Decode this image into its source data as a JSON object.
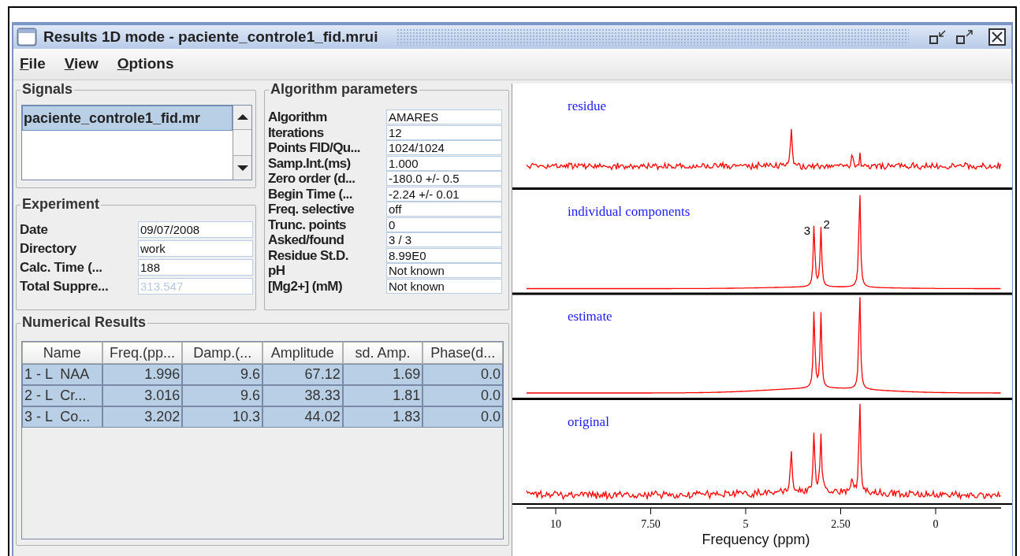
{
  "window": {
    "title": "Results 1D mode - paciente_controle1_fid.mrui"
  },
  "menu": [
    {
      "label": "File"
    },
    {
      "label": "View"
    },
    {
      "label": "Options"
    }
  ],
  "signals": {
    "title": "Signals",
    "items": [
      {
        "label": "paciente_controle1_fid.mr",
        "selected": true
      }
    ]
  },
  "experiment": {
    "title": "Experiment",
    "fields": [
      {
        "label": "Date",
        "value": "09/07/2008",
        "disabled": false
      },
      {
        "label": "Directory",
        "value": "work",
        "disabled": false
      },
      {
        "label": "Calc. Time (...",
        "value": "188",
        "disabled": false
      },
      {
        "label": "Total Suppre...",
        "value": "313.547",
        "disabled": true
      }
    ]
  },
  "algorithm_parameters": {
    "title": "Algorithm parameters",
    "fields": [
      {
        "label": "Algorithm",
        "value": "AMARES"
      },
      {
        "label": "Iterations",
        "value": "12"
      },
      {
        "label": "Points FID/Qu...",
        "value": "1024/1024"
      },
      {
        "label": "Samp.Int.(ms)",
        "value": "1.000"
      },
      {
        "label": "Zero order (d...",
        "value": "-180.0 +/- 0.5"
      },
      {
        "label": "Begin Time (...",
        "value": "-2.24 +/- 0.01"
      },
      {
        "label": "Freq. selective",
        "value": "off"
      },
      {
        "label": "Trunc. points",
        "value": "0"
      },
      {
        "label": "Asked/found",
        "value": "3 / 3"
      },
      {
        "label": "Residue St.D.",
        "value": "8.99E0"
      },
      {
        "label": "pH",
        "value": "Not known"
      },
      {
        "label": "[Mg2+] (mM)",
        "value": "Not known"
      }
    ]
  },
  "numerical_results": {
    "title": "Numerical Results",
    "columns": [
      "Name",
      "Freq.(pp...",
      "Damp.(...",
      "Amplitude",
      "sd. Amp.",
      "Phase(d..."
    ],
    "rows": [
      {
        "cells": [
          "1 - L  NAA",
          "1.996",
          "9.6",
          "67.12",
          "1.69",
          "0.0"
        ],
        "selected": true
      },
      {
        "cells": [
          "2 - L  Cr...",
          "3.016",
          "9.6",
          "38.33",
          "1.81",
          "0.0"
        ],
        "selected": true
      },
      {
        "cells": [
          "3 - L  Co...",
          "3.202",
          "10.3",
          "44.02",
          "1.83",
          "0.0"
        ],
        "selected": true
      }
    ]
  },
  "spectra": {
    "panels": [
      {
        "label": "residue",
        "kind": "residue"
      },
      {
        "label": "individual components",
        "kind": "components",
        "peak_labels": [
          "3",
          "2"
        ]
      },
      {
        "label": "estimate",
        "kind": "estimate"
      },
      {
        "label": "original",
        "kind": "original"
      }
    ],
    "x_axis": {
      "ticks": [
        "10",
        "7.50",
        "5",
        "2.50",
        "0"
      ],
      "label": "Frequency (ppm)"
    }
  }
}
